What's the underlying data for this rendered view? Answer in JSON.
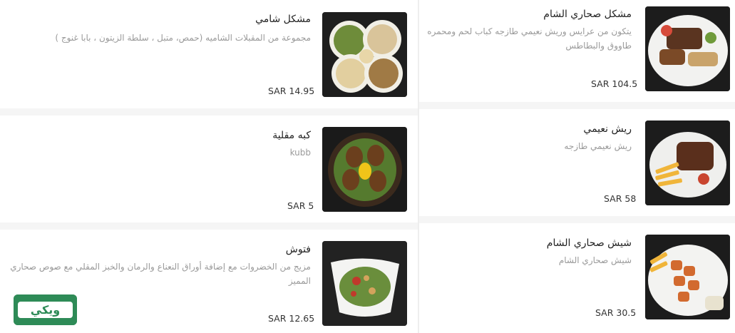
{
  "menu": {
    "left": [
      {
        "name": "مشكل شامي",
        "description": "مجموعة من المقبلات الشاميه (حمص، متبل ، سلطة الزيتون ، بابا غنوج )",
        "price": "SAR 14.95"
      },
      {
        "name": "كبه مقلية",
        "description": "kubb",
        "price": "SAR 5"
      },
      {
        "name": "فتوش",
        "description": "مزيج من الخضروات مع إضافة أوراق النعناع والرمان والخبز المقلي مع صوص صحاري المميز",
        "price": "SAR 12.65"
      }
    ],
    "right": [
      {
        "name": "مشكل صحاري الشام",
        "description": "يتكون من عرايس وريش نعيمي طازجه كباب لحم ومحمره طاووق والبطاطس",
        "price": "SAR 104.5"
      },
      {
        "name": "ريش نعيمي",
        "description": "ريش نعيمي طازجه",
        "price": "SAR 58"
      },
      {
        "name": "شيش صحاري الشام",
        "description": "شيش صحاري الشام",
        "price": "SAR 30.5"
      }
    ]
  },
  "watermark": {
    "text": "ويكي",
    "color": "#2e8b57"
  }
}
